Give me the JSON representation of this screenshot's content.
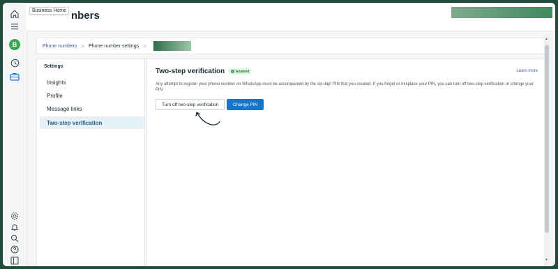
{
  "header": {
    "title": "nbers",
    "tooltip": "Business Home"
  },
  "sidebar": {
    "avatar_initial": "B",
    "top_icons": [
      "home-icon",
      "menu-icon",
      "clock-icon",
      "briefcase-icon"
    ],
    "bottom_icons": [
      "gear-icon",
      "bell-icon",
      "search-icon",
      "help-icon",
      "panel-icon"
    ]
  },
  "breadcrumb": {
    "items": [
      "Phone numbers",
      "Phone number settings"
    ],
    "separator": ">"
  },
  "settings": {
    "heading": "Settings",
    "items": [
      "Insights",
      "Profile",
      "Message links",
      "Two-step verification"
    ],
    "active_index": 3
  },
  "main": {
    "title": "Two-step verification",
    "badge": "Enabled",
    "learn_more": "Learn more",
    "description": "Any attempt to register your phone number on WhatsApp must be accompanied by the six-digit PIN that you created. If you forget or misplace your PIN, you can turn off two-step verification or change your PIN.",
    "turn_off_button": "Turn off two-step verification",
    "change_pin_button": "Change PIN"
  },
  "colors": {
    "accent": "#1b74c5",
    "active_bg": "#e5f1f8",
    "enabled_green": "#2f9a4c",
    "frame": "#1f4d3a"
  }
}
